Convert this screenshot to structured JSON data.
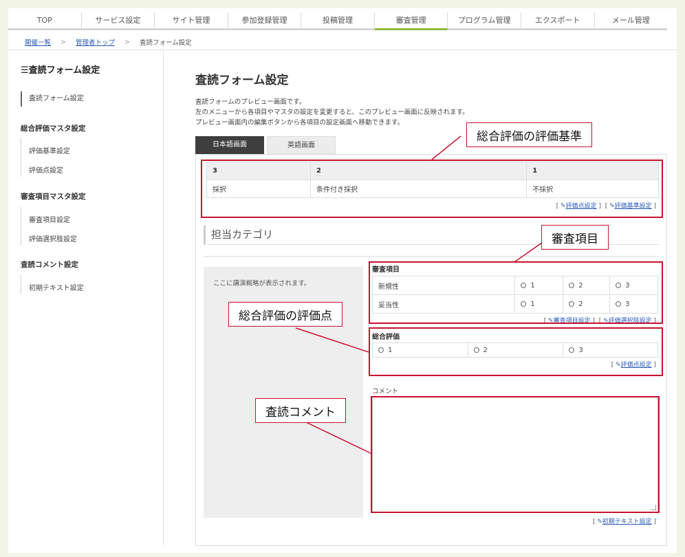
{
  "nav": {
    "tabs": [
      "TOP",
      "サービス設定",
      "サイト管理",
      "参加登録管理",
      "投稿管理",
      "審査管理",
      "プログラム管理",
      "エクスポート",
      "メール管理"
    ],
    "active_index": 5
  },
  "breadcrumb": {
    "items": [
      "開催一覧",
      "管理者トップ",
      "査読フォーム設定"
    ]
  },
  "sidebar": {
    "title": "査読フォーム設定",
    "current_item": "査読フォーム設定",
    "section1_title": "総合評価マスタ設定",
    "section1_items": [
      "評価基準設定",
      "評価点設定"
    ],
    "section2_title": "審査項目マスタ設定",
    "section2_items": [
      "審査項目設定",
      "評価選択肢設定"
    ],
    "section3_title": "査読コメント設定",
    "section3_items": [
      "初期テキスト設定"
    ]
  },
  "main": {
    "title": "査読フォーム設定",
    "description": [
      "査読フォームのプレビュー画面です。",
      "左のメニューから各項目やマスタの設定を変更すると、このプレビュー画面に反映されます。",
      "プレビュー画面内の編集ボタンから各項目の設定画面へ移動できます。"
    ],
    "lang_tabs": [
      "日本語画面",
      "英語画面"
    ]
  },
  "criteria": {
    "headers": [
      "3",
      "2",
      "1"
    ],
    "values": [
      "採択",
      "条件付き採択",
      "不採択"
    ],
    "link1": "評価点設定",
    "link2": "評価基準設定"
  },
  "category": {
    "title": "担当カテゴリ",
    "placeholder": "ここに講演概略が表示されます。"
  },
  "review_items": {
    "title": "審査項目",
    "rows": [
      {
        "label": "新規性",
        "options": [
          "1",
          "2",
          "3"
        ]
      },
      {
        "label": "妥当性",
        "options": [
          "1",
          "2",
          "3"
        ]
      }
    ],
    "link1": "審査項目設定",
    "link2": "評価選択肢設定"
  },
  "overall": {
    "title": "総合評価",
    "options": [
      "1",
      "2",
      "3"
    ],
    "link": "評価点設定"
  },
  "comment": {
    "label": "コメント",
    "link": "初期テキスト設定"
  },
  "callouts": {
    "criteria": "総合評価の評価基準",
    "items": "審査項目",
    "points": "総合評価の評価点",
    "comment": "査読コメント"
  },
  "colors": {
    "accent": "#8fbc3c",
    "annotation": "#c8102e",
    "link": "#2a5bb5"
  },
  "icons": [
    "pencil-icon",
    "hamburger-icon",
    "chevron-right-icon"
  ]
}
